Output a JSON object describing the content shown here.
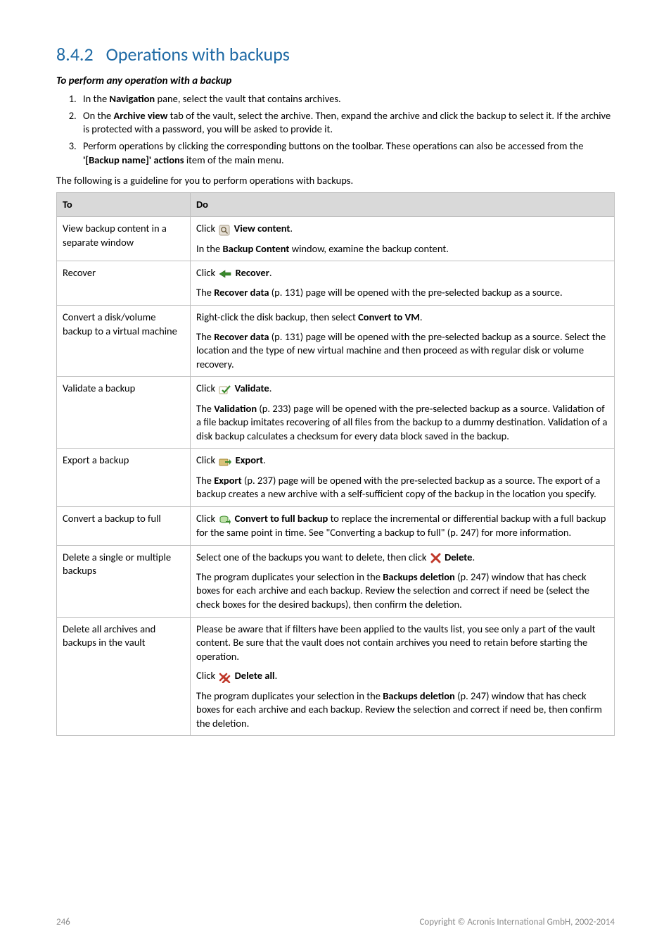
{
  "heading": {
    "number": "8.4.2",
    "title": "Operations with backups"
  },
  "subhead": "To perform any operation with a backup",
  "steps": [
    {
      "pre": "In the ",
      "bold": "Navigation",
      "post": " pane, select the vault that contains archives."
    },
    {
      "pre": "On the ",
      "bold": "Archive view",
      "post": " tab of the vault, select the archive. Then, expand the archive and click the backup to select it. If the archive is protected with a password, you will be asked to provide it."
    },
    {
      "pre": "Perform operations by clicking the corresponding buttons on the toolbar. These operations can also be accessed from the ",
      "bold": "'[Backup name]' actions",
      "post": " item of the main menu."
    }
  ],
  "intro": "The following is a guideline for you to perform operations with backups.",
  "table": {
    "headers": {
      "to": "To",
      "do": "Do"
    },
    "rows": {
      "view": {
        "to": "View backup content in a separate window",
        "click": "Click ",
        "label": "View content",
        "dot": ".",
        "desc_pre": "In the ",
        "desc_bold": "Backup Content",
        "desc_post": " window, examine the backup content."
      },
      "recover": {
        "to": "Recover",
        "click": "Click ",
        "label": "Recover",
        "dot": ".",
        "d1": "The ",
        "d1b": "Recover data",
        "d1post": " (p. 131) page will be opened with the pre-selected backup as a source."
      },
      "convertvm": {
        "to": "Convert a disk/volume backup to a virtual machine",
        "l1a": "Right-click the disk backup, then select ",
        "l1b": "Convert to VM",
        "l1c": ".",
        "d1": "The ",
        "d1b": "Recover data",
        "d1post": " (p. 131) page will be opened with the pre-selected backup as a source. Select the location and the type of new virtual machine and then proceed as with regular disk or volume recovery."
      },
      "validate": {
        "to": "Validate a backup",
        "click": "Click ",
        "label": "Validate",
        "dot": ".",
        "d1": "The ",
        "d1b": "Validation",
        "d1post": " (p. 233) page will be opened with the pre-selected backup as a source. Validation of a file backup imitates recovering of all files from the backup to a dummy destination. Validation of a disk backup calculates a checksum for every data block saved in the backup."
      },
      "export": {
        "to": "Export a backup",
        "click": "Click ",
        "label": "Export",
        "dot": ".",
        "d1": "The ",
        "d1b": "Export",
        "d1post": " (p. 237) page will be opened with the pre-selected backup as a source. The export of a backup creates a new archive with a self-sufficient copy of the backup in the location you specify."
      },
      "convertfull": {
        "to": "Convert a backup to full",
        "click": "Click ",
        "label": "Convert to full backup",
        "post": " to replace the incremental or differential backup with a full backup for the same point in time. See \"Converting a backup to full\" (p. 247) for more information."
      },
      "delete": {
        "to": "Delete a single or multiple backups",
        "sel": "Select one of the backups you want to delete, then click ",
        "label": "Delete",
        "dot": ".",
        "d1": "The program duplicates your selection in the ",
        "d1b": "Backups deletion",
        "d1post": " (p. 247) window that has check boxes for each archive and each backup. Review the selection and correct if need be (select the check boxes for the desired backups), then confirm the deletion."
      },
      "deleteall": {
        "to": "Delete all archives and backups in the vault",
        "p1": "Please be aware that if filters have been applied to the vaults list, you see only a part of the vault content. Be sure that the vault does not contain archives you need to retain before starting the operation.",
        "click": "Click ",
        "label": "Delete all",
        "dot": ".",
        "d1": "The program duplicates your selection in the ",
        "d1b": "Backups deletion",
        "d1post": " (p. 247) window that has check boxes for each archive and each backup. Review the selection and correct if need be, then confirm the deletion."
      }
    }
  },
  "footer": {
    "page": "246",
    "copyright": "Copyright © Acronis International GmbH, 2002-2014"
  }
}
